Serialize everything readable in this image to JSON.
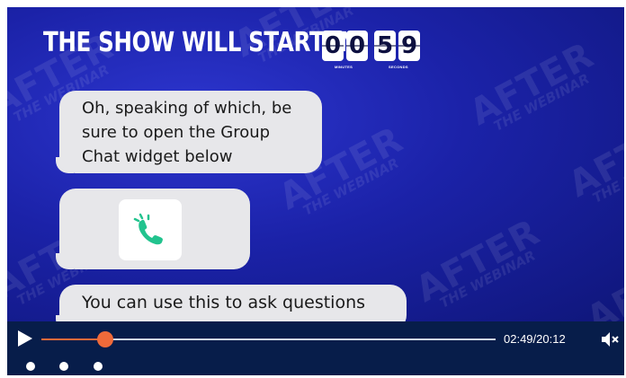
{
  "video": {
    "headline": "THE SHOW WILL START IN",
    "countdown": {
      "minutes_digits": [
        "0",
        "0"
      ],
      "seconds_digits": [
        "5",
        "9"
      ],
      "minutes_label": "MINUTES",
      "seconds_label": "SECONDS"
    },
    "watermark": {
      "big": "AFTER",
      "small": "THE WEBINAR"
    },
    "messages": {
      "first_lines": [
        "Oh, speaking of which, be",
        "sure to open the Group",
        "Chat widget below"
      ],
      "second": "chat-bubble-icon",
      "third": "You can use this to ask questions"
    }
  },
  "player": {
    "time": "02:49/20:12",
    "progress_fraction": 0.14,
    "play_icon": "play-icon",
    "mute_icon": "volume-muted-icon"
  },
  "colors": {
    "accent": "#ef6a3a",
    "chat_icon_green": "#22c38e"
  }
}
